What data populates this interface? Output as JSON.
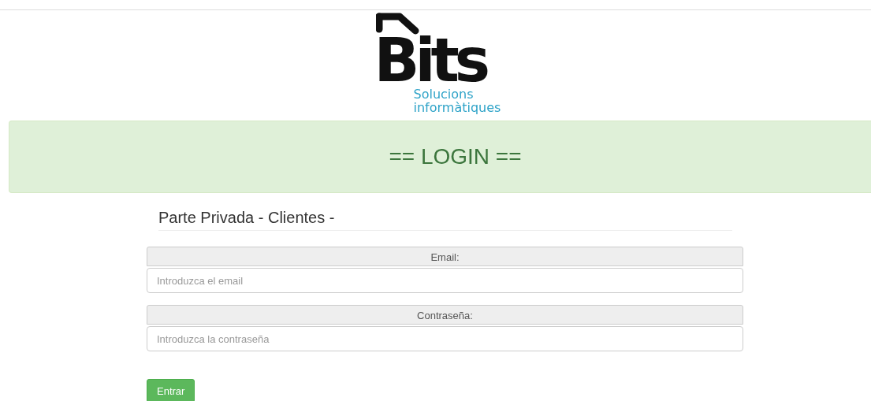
{
  "logo": {
    "wordmark": "Bits",
    "tagline": [
      "Solucions",
      "informàtiques"
    ]
  },
  "banner": {
    "title": "== LOGIN =="
  },
  "form": {
    "heading": "Parte Privada - Clientes -",
    "fields": [
      {
        "label": "Email:",
        "placeholder": "Introduzca el email"
      },
      {
        "label": "Contraseña:",
        "placeholder": "Introduzca la contraseña"
      }
    ],
    "submit": "Entrar"
  }
}
